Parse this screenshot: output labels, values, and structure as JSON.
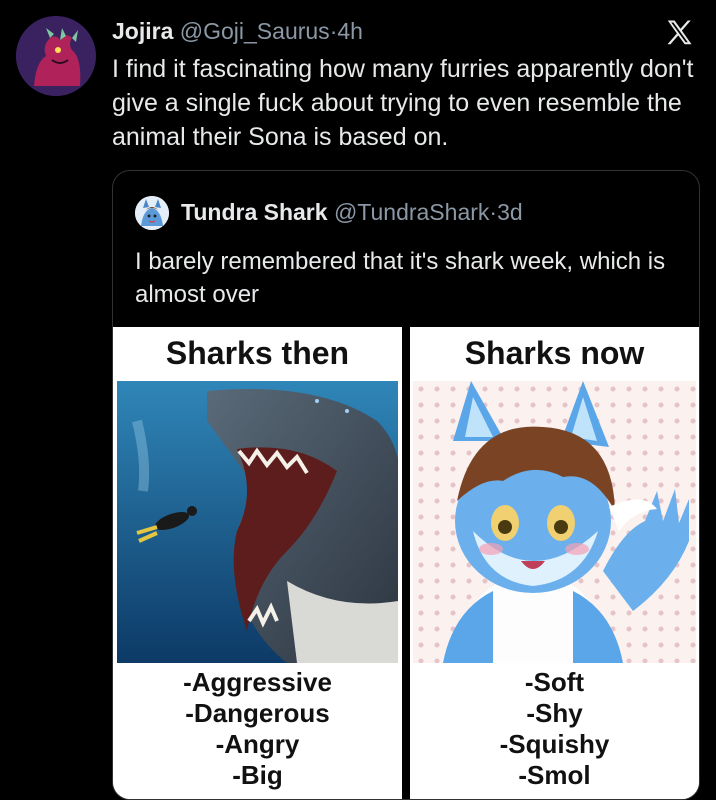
{
  "tweet": {
    "avatar_icon": "dragon-avatar-icon",
    "author_name": "Jojira",
    "author_handle": "@Goji_Saurus",
    "separator": "·",
    "time": "4h",
    "platform_icon": "x-logo-icon",
    "text": "I find it fascinating how many furries apparently don't give a single fuck about trying to even resemble the animal their Sona is based on."
  },
  "quoted_tweet": {
    "avatar_icon": "shark-furry-avatar-icon",
    "author_name": "Tundra Shark",
    "author_handle": "@TundraShark",
    "separator": "·",
    "time": "3d",
    "text": "I barely remembered that it's shark week, which is almost over",
    "meme": {
      "left": {
        "title": "Sharks then",
        "image_icon": "great-white-shark-and-diver-image",
        "traits": [
          "-Aggressive",
          "-Dangerous",
          "-Angry",
          "-Big"
        ]
      },
      "right": {
        "title": "Sharks now",
        "image_icon": "cute-blue-shark-furry-image",
        "traits": [
          "-Soft",
          "-Shy",
          "-Squishy",
          "-Smol"
        ]
      }
    }
  },
  "colors": {
    "background": "#000000",
    "text_primary": "#e7e9ea",
    "text_secondary": "#8b98a5",
    "border": "#2f3336",
    "meme_bg": "#ffffff"
  }
}
